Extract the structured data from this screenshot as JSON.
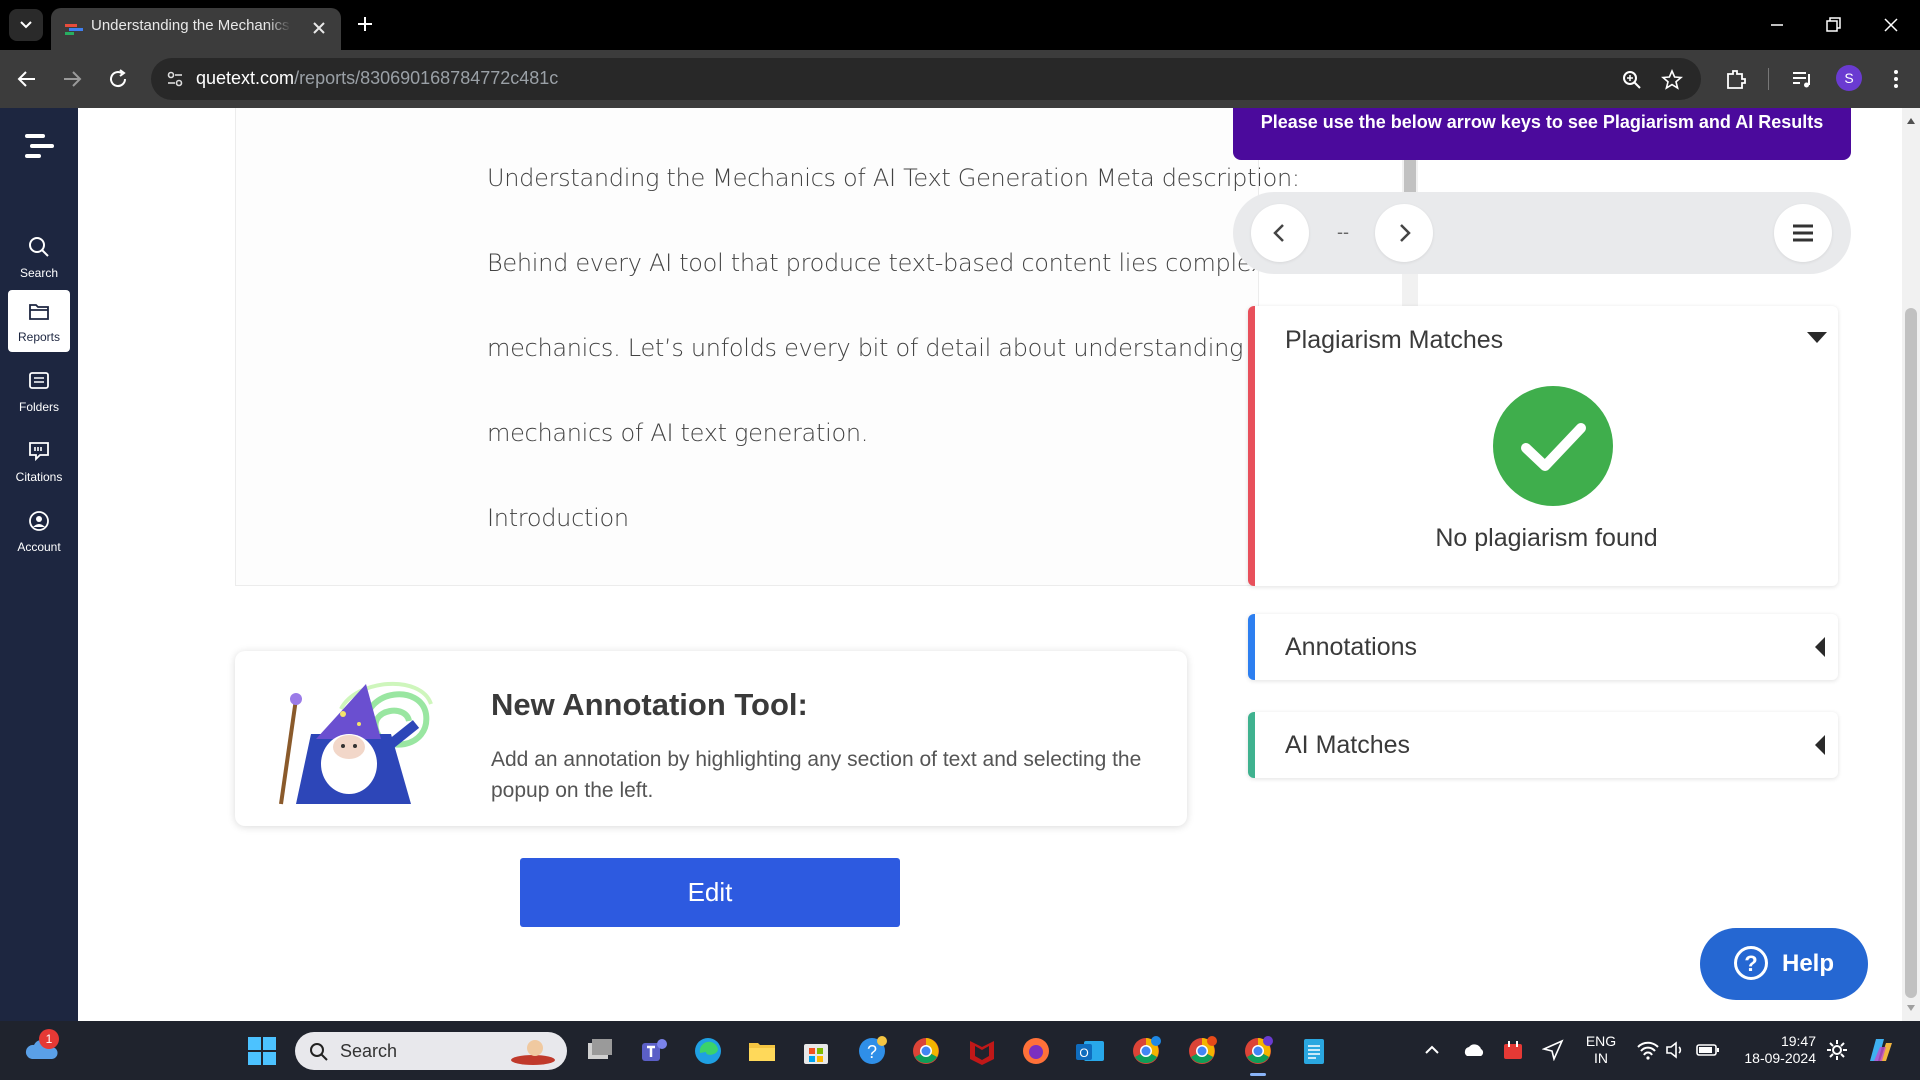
{
  "browser": {
    "tab_title": "Understanding the Mechanics of AI Text Generation",
    "url_host": "quetext.com",
    "url_path": "/reports/830690168784772c481c"
  },
  "sidebar": {
    "items": [
      {
        "label": "Search",
        "icon": "search-icon"
      },
      {
        "label": "Reports",
        "icon": "folder-icon"
      },
      {
        "label": "Folders",
        "icon": "list-icon"
      },
      {
        "label": "Citations",
        "icon": "citation-icon"
      },
      {
        "label": "Account",
        "icon": "account-icon"
      }
    ]
  },
  "editor": {
    "lines": [
      "Understanding the Mechanics of AI Text Generation Meta description:",
      "Behind every AI tool that produce text-based content lies complex",
      "mechanics. Let’s unfolds every bit of detail about understanding the",
      "mechanics of AI text generation.",
      "Introduction"
    ]
  },
  "annotation_tool": {
    "title": "New Annotation Tool:",
    "text": "Add an annotation by highlighting any section of text and selecting the popup on the left."
  },
  "edit_button": "Edit",
  "results": {
    "banner": "Please use the below arrow keys to see Plagiarism and AI Results",
    "nav_count": "--",
    "plagiarism": {
      "title": "Plagiarism Matches",
      "status": "No plagiarism found",
      "accent": "#e8505b"
    },
    "annotations": {
      "title": "Annotations",
      "accent": "#2d7ff0"
    },
    "ai_matches": {
      "title": "AI Matches",
      "accent": "#3fb28f"
    }
  },
  "help_button": "Help",
  "taskbar": {
    "search_placeholder": "Search",
    "weather_badge": "1",
    "lang_line1": "ENG",
    "lang_line2": "IN",
    "time": "19:47",
    "date": "18-09-2024"
  },
  "colors": {
    "sidebar_bg": "#1d2640",
    "banner_bg": "#4b0a9c",
    "edit_button_bg": "#2d5ae0",
    "help_button_bg": "#2567d2",
    "check_green": "#3fae4c"
  }
}
